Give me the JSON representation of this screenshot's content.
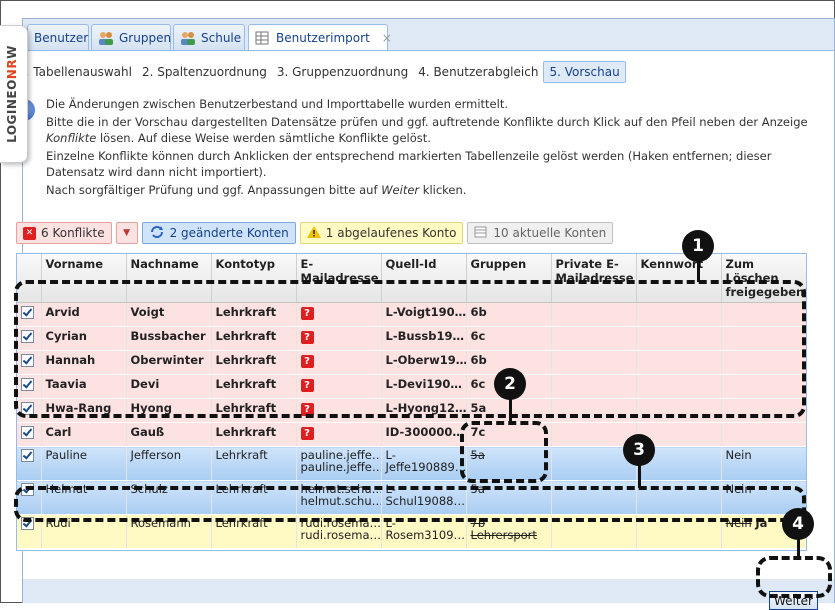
{
  "logo": {
    "part1": "LOGINEO",
    "part2": "NR",
    "part3": "W"
  },
  "tabs": [
    {
      "label": "Benutzer"
    },
    {
      "label": "Gruppen"
    },
    {
      "label": "Schule"
    },
    {
      "label": "Benutzerimport",
      "close": "×"
    }
  ],
  "steps": [
    "1. Tabellenauswahl",
    "2. Spaltenzuordnung",
    "3. Gruppenzuordnung",
    "4. Benutzerabgleich",
    "5. Vorschau"
  ],
  "info": {
    "p1": "Die Änderungen zwischen Benutzerbestand und Importtabelle wurden ermittelt.",
    "p2a": "Bitte die in der Vorschau dargestellten Datensätze prüfen und ggf. auftretende Konflikte durch Klick auf den Pfeil neben der Anzeige ",
    "p2b": "Konflikte",
    "p2c": " lösen. Auf diese Weise werden sämtliche Konflikte gelöst.",
    "p3": "Einzelne Konflikte können durch Anklicken der entsprechend markierten Tabellenzeile gelöst werden (Haken entfernen; dieser Datensatz wird dann nicht importiert).",
    "p4a": "Nach sorgfältiger Prüfung und ggf. Anpassungen bitte auf ",
    "p4b": "Weiter",
    "p4c": " klicken."
  },
  "filters": {
    "conflicts": "6 Konflikte",
    "arrow": "▼",
    "changed": "2 geänderte Konten",
    "expired": "1 abgelaufenes Konto",
    "current": "10 aktuelle Konten"
  },
  "columns": [
    "Vorname",
    "Nachname",
    "Kontotyp",
    "E-Mailadresse",
    "Quell-Id",
    "Gruppen",
    "Private E-Mailadresse",
    "Kennwort",
    "Zum Löschen freigegeben"
  ],
  "conflict_rows": [
    {
      "vorname": "Arvid",
      "nachname": "Voigt",
      "typ": "Lehrkraft",
      "email": "?",
      "qid": "L-Voigt190…",
      "gruppe": "6b"
    },
    {
      "vorname": "Cyrian",
      "nachname": "Bussbacher",
      "typ": "Lehrkraft",
      "email": "?",
      "qid": "L-Bussb19…",
      "gruppe": "6c"
    },
    {
      "vorname": "Hannah",
      "nachname": "Oberwinter",
      "typ": "Lehrkraft",
      "email": "?",
      "qid": "L-Oberw19…",
      "gruppe": "6b"
    },
    {
      "vorname": "Taavia",
      "nachname": "Devi",
      "typ": "Lehrkraft",
      "email": "?",
      "qid": "L-Devi190…",
      "gruppe": "6c"
    },
    {
      "vorname": "Hwa-Rang",
      "nachname": "Hyong",
      "typ": "Lehrkraft",
      "email": "?",
      "qid": "L-Hyong12…",
      "gruppe": "5a"
    },
    {
      "vorname": "Carl",
      "nachname": "Gauß",
      "typ": "Lehrkraft",
      "email": "?",
      "qid": "ID-300000…",
      "gruppe": "7c"
    }
  ],
  "changed_rows": [
    {
      "vorname": "Pauline",
      "nachname": "Jefferson",
      "typ": "Lehrkraft",
      "email1": "pauline.jeffe…",
      "email2": "pauline.jeffe…",
      "qid1": "L-",
      "qid2": "Jeffe190889…",
      "gruppe": "5a",
      "loeschen": "Nein"
    },
    {
      "vorname": "Helmut",
      "nachname": "Schulz",
      "typ": "Lehrkraft",
      "email1": "helmut.schu…",
      "email2": "helmut.schu…",
      "qid1": "L-",
      "qid2": "Schul19088…",
      "gruppe": "5a",
      "loeschen": "Nein"
    }
  ],
  "expired_row": {
    "vorname": "Rudi",
    "nachname": "Rosemann",
    "typ": "Lehrkraft",
    "email1": "rudi.rosema…",
    "email2": "rudi.rosema…",
    "qid1": "L-",
    "qid2": "Rosem3109…",
    "gruppe1": "7b",
    "gruppe2": "Lehrersport",
    "loeschen_old": "Nein",
    "loeschen_new": "Ja"
  },
  "weiter": "Weiter",
  "annotations": [
    "1",
    "2",
    "3",
    "4"
  ]
}
